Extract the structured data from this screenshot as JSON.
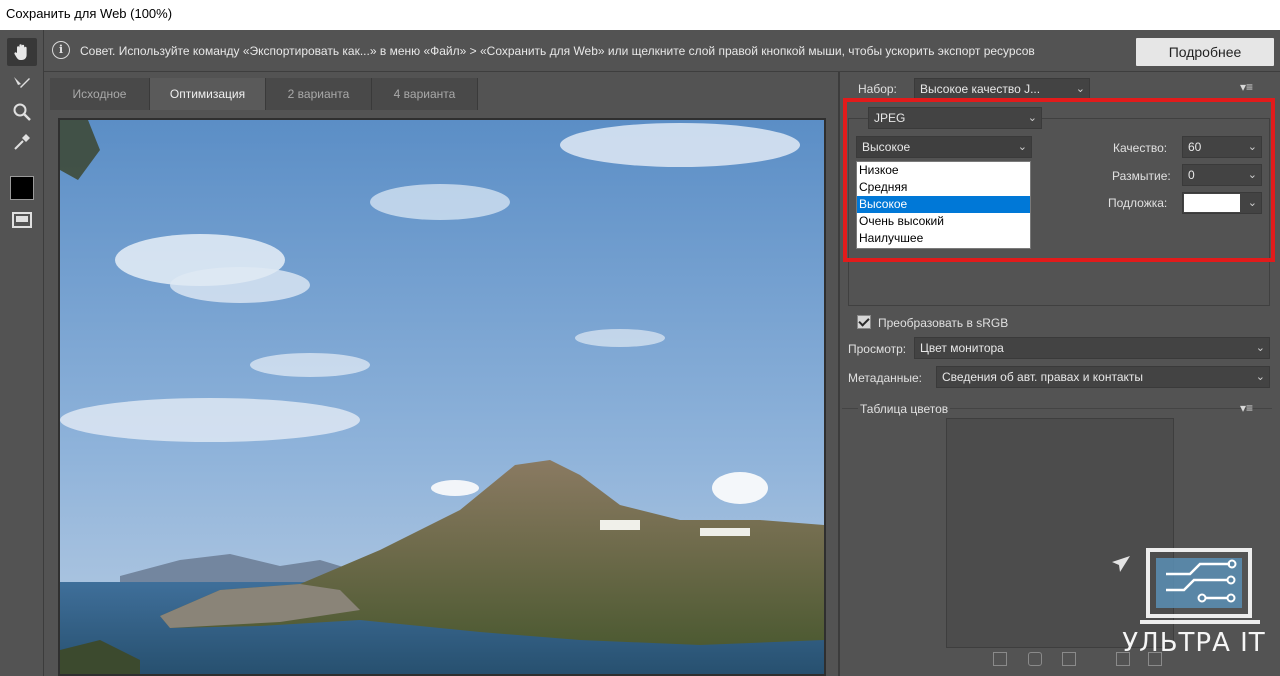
{
  "window": {
    "title": "Сохранить для Web (100%)"
  },
  "infobar": {
    "tip": "Совет. Используйте команду «Экспортировать как...» в меню «Файл» > «Сохранить для Web» или щелкните слой правой кнопкой мыши, чтобы ускорить экспорт ресурсов",
    "more_button": "Подробнее"
  },
  "tools": [
    "hand-tool",
    "slice-select-tool",
    "zoom-tool",
    "eyedropper-tool",
    "eyedropper-color",
    "toggle-slices-visibility"
  ],
  "tabs": [
    {
      "label": "Исходное",
      "active": false
    },
    {
      "label": "Оптимизация",
      "active": true
    },
    {
      "label": "2 варианта",
      "active": false
    },
    {
      "label": "4 варианта",
      "active": false
    }
  ],
  "settings": {
    "preset_label": "Набор:",
    "preset_value": "Высокое качество J...",
    "format": "JPEG",
    "quality_preset": "Высокое",
    "quality_options": [
      "Низкое",
      "Средняя",
      "Высокое",
      "Очень высокий",
      "Наилучшее"
    ],
    "quality_label": "Качество:",
    "quality_value": "60",
    "blur_label": "Размытие:",
    "blur_value": "0",
    "matte_label": "Подложка:",
    "matte_color": "#ffffff",
    "convert_srgb_label": "Преобразовать в sRGB",
    "convert_srgb_checked": true,
    "preview_label": "Просмотр:",
    "preview_value": "Цвет монитора",
    "metadata_label": "Метаданные:",
    "metadata_value": "Сведения об авт. правах и контакты"
  },
  "color_table": {
    "title": "Таблица цветов"
  },
  "watermark": {
    "text": "УЛЬТРА IT"
  },
  "colors": {
    "highlight": "#e21b1b",
    "selection": "#0078d7",
    "panel": "#535353"
  }
}
